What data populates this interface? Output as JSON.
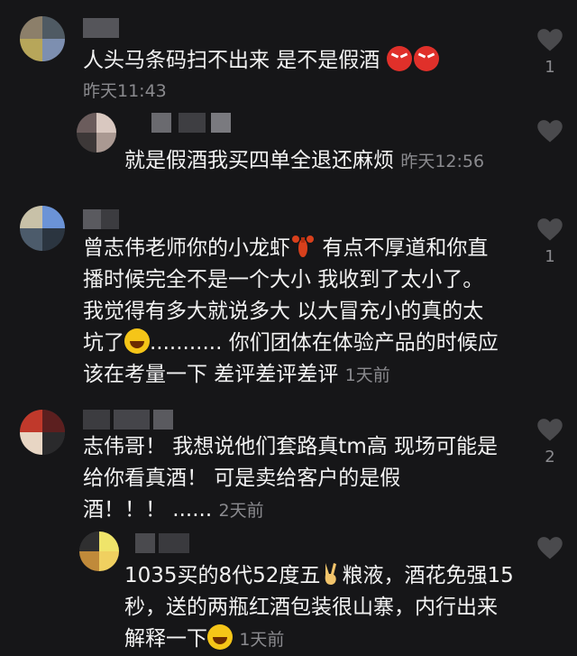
{
  "comments": [
    {
      "text": "人头马条码扫不出来 是不是假酒",
      "emoji": [
        "angry-face",
        "angry-face"
      ],
      "time": "昨天11:43",
      "likes": "1"
    },
    {
      "text": "就是假酒我买四单全退还麻烦",
      "time": "昨天12:56",
      "likes": ""
    },
    {
      "lines": [
        "曾志伟老师你的小龙虾",
        "有点不厚道和你直",
        "播时候完全不是一个大小 我收到了太小了。",
        "我觉得有多大就说多大 以大冒充小的真的太",
        "坑了",
        "........... 你们团体在体验产品的时候应",
        "该在考量一下 差评差评差评"
      ],
      "time": "1天前",
      "likes": "1"
    },
    {
      "lines": [
        "志伟哥！ 我想说他们套路真tm高 现场可能是",
        "给你看真酒！ 可是卖给客户的是假",
        "酒！！！ ......"
      ],
      "time": "2天前",
      "likes": "2"
    },
    {
      "lines": [
        "1035买的8代52度五",
        "粮液，酒花免强15",
        "秒，送的两瓶红酒包装很山寨，内行出来",
        "解释一下"
      ],
      "time": "1天前",
      "likes": ""
    }
  ],
  "icons": {
    "like": "heart-icon",
    "angry": "angry-face-emoji",
    "laugh": "tears-of-joy-emoji",
    "lobster": "lobster-emoji",
    "peace": "victory-hand-emoji"
  },
  "colors": {
    "background": "#161618",
    "text": "#f2f2f2",
    "meta": "#8a8a8e",
    "heart": "#4a4a4d"
  }
}
